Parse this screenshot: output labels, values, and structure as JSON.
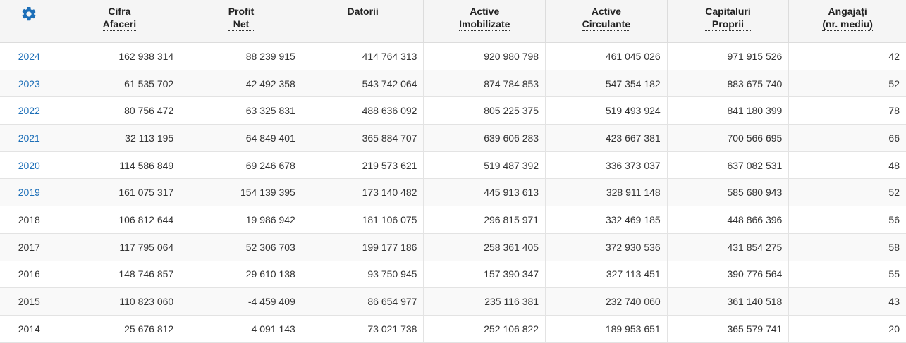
{
  "header": {
    "columns": [
      {
        "l1": "Cifra",
        "l2": "Afaceri"
      },
      {
        "l1": "Profit",
        "l2": "Net"
      },
      {
        "l1": "Datorii",
        "l2": ""
      },
      {
        "l1": "Active",
        "l2": "Imobilizate"
      },
      {
        "l1": "Active",
        "l2": "Circulante"
      },
      {
        "l1": "Capitaluri",
        "l2": "Proprii"
      },
      {
        "l1": "Angajați",
        "l2": "(nr. mediu)"
      }
    ],
    "settings_icon": "gear-icon",
    "accent_color": "#1d6fb8"
  },
  "rows": [
    {
      "year": "2024",
      "link": true,
      "cells": [
        "162 938 314",
        "88 239 915",
        "414 764 313",
        "920 980 798",
        "461 045 026",
        "971 915 526",
        "42"
      ]
    },
    {
      "year": "2023",
      "link": true,
      "cells": [
        "61 535 702",
        "42 492 358",
        "543 742 064",
        "874 784 853",
        "547 354 182",
        "883 675 740",
        "52"
      ]
    },
    {
      "year": "2022",
      "link": true,
      "cells": [
        "80 756 472",
        "63 325 831",
        "488 636 092",
        "805 225 375",
        "519 493 924",
        "841 180 399",
        "78"
      ]
    },
    {
      "year": "2021",
      "link": true,
      "cells": [
        "32 113 195",
        "64 849 401",
        "365 884 707",
        "639 606 283",
        "423 667 381",
        "700 566 695",
        "66"
      ]
    },
    {
      "year": "2020",
      "link": true,
      "cells": [
        "114 586 849",
        "69 246 678",
        "219 573 621",
        "519 487 392",
        "336 373 037",
        "637 082 531",
        "48"
      ]
    },
    {
      "year": "2019",
      "link": true,
      "cells": [
        "161 075 317",
        "154 139 395",
        "173 140 482",
        "445 913 613",
        "328 911 148",
        "585 680 943",
        "52"
      ]
    },
    {
      "year": "2018",
      "link": false,
      "cells": [
        "106 812 644",
        "19 986 942",
        "181 106 075",
        "296 815 971",
        "332 469 185",
        "448 866 396",
        "56"
      ]
    },
    {
      "year": "2017",
      "link": false,
      "cells": [
        "117 795 064",
        "52 306 703",
        "199 177 186",
        "258 361 405",
        "372 930 536",
        "431 854 275",
        "58"
      ]
    },
    {
      "year": "2016",
      "link": false,
      "cells": [
        "148 746 857",
        "29 610 138",
        "93 750 945",
        "157 390 347",
        "327 113 451",
        "390 776 564",
        "55"
      ]
    },
    {
      "year": "2015",
      "link": false,
      "cells": [
        "110 823 060",
        "-4 459 409",
        "86 654 977",
        "235 116 381",
        "232 740 060",
        "361 140 518",
        "43"
      ]
    },
    {
      "year": "2014",
      "link": false,
      "cells": [
        "25 676 812",
        "4 091 143",
        "73 021 738",
        "252 106 822",
        "189 953 651",
        "365 579 741",
        "20"
      ]
    }
  ]
}
